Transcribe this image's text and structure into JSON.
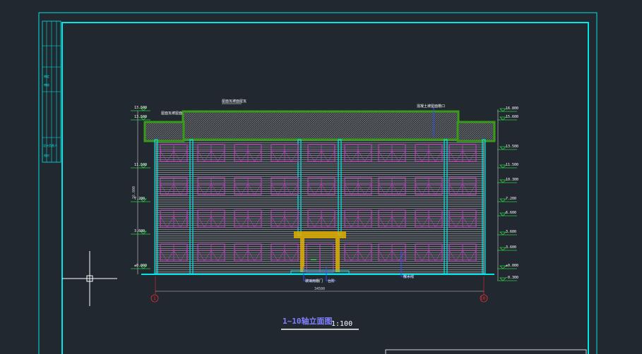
{
  "drawing": {
    "title": "1~10轴立面图",
    "scale": "1:100",
    "overall_dimension": "34500",
    "axis_start": "1",
    "axis_end": "10",
    "height_dim": "16.800",
    "roof_note_center": "屋面瓦坡面屋瓦",
    "roof_note_left": "屋面瓦坡屋面",
    "roof_note_right": "混凝土坡屋面檐口",
    "label_entrance": "玻璃雨棚门",
    "label_step": "台阶",
    "label_ramp": "散水线"
  },
  "left_levels": [
    {
      "text": "13.500"
    },
    {
      "text": "13.500"
    },
    {
      "text": "11.500"
    },
    {
      "text": "7.200"
    },
    {
      "text": "3.600"
    },
    {
      "text": "±0.000"
    }
  ],
  "right_levels": [
    {
      "text": "16.800"
    },
    {
      "text": "15.600"
    },
    {
      "text": "13.500"
    },
    {
      "text": "11.500"
    },
    {
      "text": "10.300"
    },
    {
      "text": "7.200"
    },
    {
      "text": "6.600"
    },
    {
      "text": "3.600"
    },
    {
      "text": "3.600"
    },
    {
      "text": "±0.000"
    },
    {
      "text": "-0.300"
    }
  ],
  "title_block": {
    "labels": [
      "审定",
      "审核",
      "设计负责人",
      "校对"
    ]
  },
  "colors": {
    "background": "#212830",
    "frame": "#00e5e5",
    "roof": "#3a9a1a",
    "window": "#c040c0",
    "hatch": "#9a9a9a",
    "level_green": "#2ecc40",
    "dim_red": "#e03030",
    "title_blue": "#8080ff",
    "entrance_yellow": "#e0b000"
  }
}
